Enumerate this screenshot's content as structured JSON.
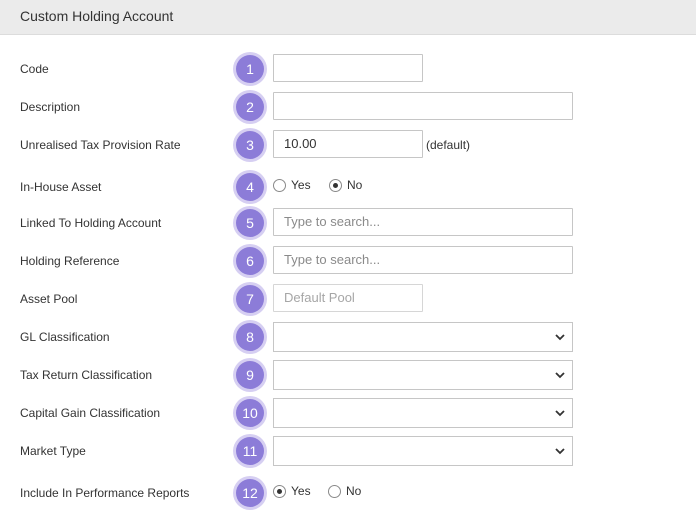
{
  "header": {
    "title": "Custom Holding Account"
  },
  "fields": [
    {
      "label": "Code",
      "badge": "1",
      "value": ""
    },
    {
      "label": "Description",
      "badge": "2",
      "value": ""
    },
    {
      "label": "Unrealised Tax Provision Rate",
      "badge": "3",
      "value": "10.00",
      "suffix": "(default)"
    },
    {
      "label": "In-House Asset",
      "badge": "4",
      "options": [
        "Yes",
        "No"
      ],
      "selected": "No"
    },
    {
      "label": "Linked To Holding Account",
      "badge": "5",
      "placeholder": "Type to search..."
    },
    {
      "label": "Holding Reference",
      "badge": "6",
      "placeholder": "Type to search..."
    },
    {
      "label": "Asset Pool",
      "badge": "7",
      "placeholder": "Default Pool"
    },
    {
      "label": "GL Classification",
      "badge": "8",
      "value": ""
    },
    {
      "label": "Tax Return Classification",
      "badge": "9",
      "value": ""
    },
    {
      "label": "Capital Gain Classification",
      "badge": "10",
      "value": ""
    },
    {
      "label": "Market Type",
      "badge": "11",
      "value": ""
    },
    {
      "label": "Include In Performance Reports",
      "badge": "12",
      "options": [
        "Yes",
        "No"
      ],
      "selected": "Yes"
    }
  ],
  "icons": {
    "dropdown": "chevron-down-icon"
  },
  "colors": {
    "badge": "#8c7cd8",
    "badge_ring": "#d6cff2",
    "header_bg": "#ebebeb"
  }
}
